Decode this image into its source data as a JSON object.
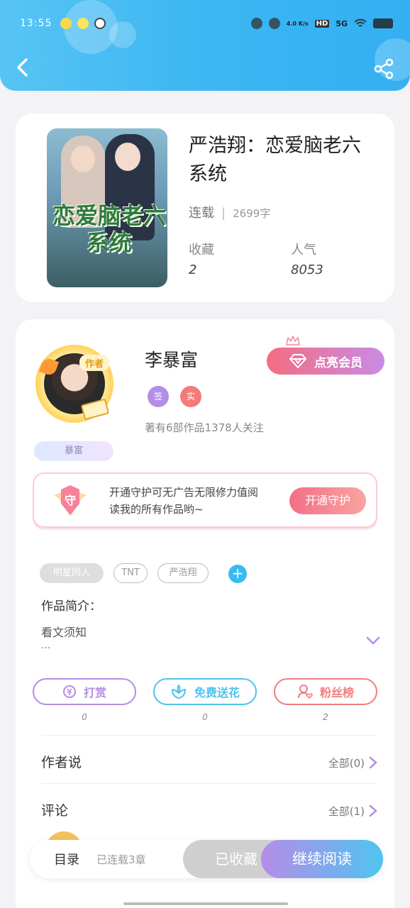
{
  "status_bar": {
    "time": "13:55",
    "network_speed": "4.0 K/s",
    "network": "5G"
  },
  "book": {
    "title": "严浩翔：恋爱脑老六系统",
    "cover_title": "恋爱脑老六系统",
    "status": "连载",
    "word_count": "2699字",
    "collect_label": "收藏",
    "collect_value": "2",
    "popularity_label": "人气",
    "popularity_value": "8053"
  },
  "author": {
    "role_tag": "作者",
    "name": "李暴富",
    "nickname": "暴富",
    "vip_button": "点亮会员",
    "badge_sign": "签",
    "badge_real": "实",
    "stats": "著有6部作品1378人关注"
  },
  "guard": {
    "icon_text": "守",
    "text": "开通守护可无广告无限修力值阅读我的所有作品哟~",
    "button": "开通守护"
  },
  "tags": [
    "明星同人",
    "TNT",
    "严浩翔"
  ],
  "intro": {
    "label": "作品简介：",
    "text": "看文须知",
    "more": "..."
  },
  "actions": [
    {
      "label": "打赏",
      "count": "0",
      "color": "#b58ce3",
      "icon": "yen-coin-icon"
    },
    {
      "label": "免费送花",
      "count": "0",
      "color": "#4cc3ee",
      "icon": "flower-icon"
    },
    {
      "label": "粉丝榜",
      "count": "2",
      "color": "#ef7d7d",
      "icon": "fans-icon"
    }
  ],
  "author_says": {
    "label": "作者说",
    "link": "全部(0)"
  },
  "comments": {
    "label": "评论",
    "link": "全部(1)",
    "preview": "…"
  },
  "bottom_bar": {
    "toc_label": "目录",
    "toc_sub": "已连载3章",
    "collected_label": "已收藏",
    "continue_label": "继续阅读"
  }
}
